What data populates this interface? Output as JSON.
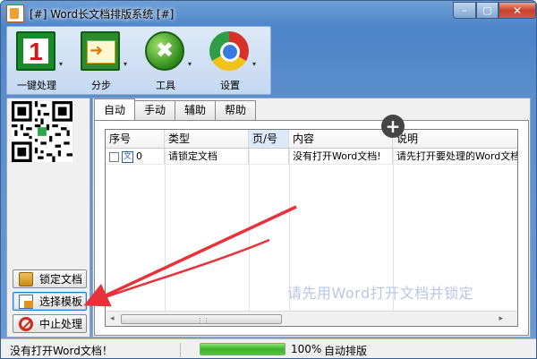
{
  "window": {
    "title": "[#] Word长文档排版系统 [#]",
    "buttons": {
      "minimize": "–",
      "maximize": "▢",
      "close": "✕"
    }
  },
  "toolbar": {
    "items": [
      {
        "label": "一键处理",
        "icon": "one-click-icon",
        "glyph": "1"
      },
      {
        "label": "分步",
        "icon": "step-icon",
        "glyph": "➜"
      },
      {
        "label": "工具",
        "icon": "tools-icon",
        "glyph": "✖"
      },
      {
        "label": "设置",
        "icon": "settings-icon"
      }
    ],
    "dropdown_glyph": "▾"
  },
  "sidebar": {
    "buttons": [
      {
        "label": "锁定文档",
        "icon": "lock-icon"
      },
      {
        "label": "选择模板",
        "icon": "template-icon"
      },
      {
        "label": "中止处理",
        "icon": "stop-icon"
      }
    ]
  },
  "tabs": [
    {
      "label": "自动",
      "active": true
    },
    {
      "label": "手动",
      "active": false
    },
    {
      "label": "辅助",
      "active": false
    },
    {
      "label": "帮助",
      "active": false
    }
  ],
  "grid": {
    "columns": [
      "序号",
      "类型",
      "页/号",
      "内容",
      "说明"
    ],
    "rows": [
      {
        "index": "0",
        "doc_glyph": "文",
        "type": "请锁定文档",
        "page": "",
        "content": "没有打开Word文档!",
        "note": "请先打开要处理的Word文档"
      }
    ],
    "scroll_left": "◂",
    "scroll_right": "▸",
    "scroll_grip": "⋮⋮"
  },
  "overlay": {
    "plus": "+"
  },
  "hint": "请先用Word打开文档并锁定",
  "status": {
    "message": "没有打开Word文档！",
    "progress": 100,
    "progress_text": "100%",
    "mode": "自动排版"
  },
  "colors": {
    "arrow": "#e8323a",
    "progress": "#3bb225",
    "title_bar": "#4d84c8"
  }
}
